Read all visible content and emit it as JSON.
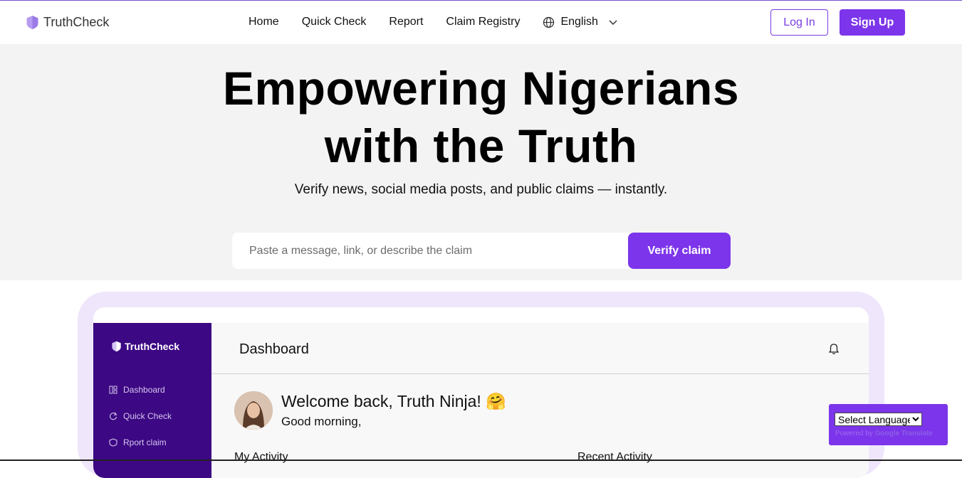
{
  "nav": {
    "brand": "TruthCheck",
    "links": [
      "Home",
      "Quick Check",
      "Report",
      "Claim Registry"
    ],
    "language": "English",
    "login": "Log In",
    "signup": "Sign Up"
  },
  "hero": {
    "title_line1": "Empowering Nigerians",
    "title_line2": "with the Truth",
    "subtitle": "Verify news, social media posts, and public claims — instantly.",
    "search_placeholder": "Paste a message, link, or describe the claim",
    "verify_button": "Verify claim"
  },
  "preview": {
    "brand": "TruthCheck",
    "sidebar": [
      "Dashboard",
      "Quick Check",
      "Rport claim"
    ],
    "header_title": "Dashboard",
    "welcome": "Welcome back, Truth Ninja! 🤗",
    "greeting": "Good morning,",
    "section_left": "My Activity",
    "section_right": "Recent Activity"
  },
  "translate": {
    "select_label": "Select Language",
    "powered_by": "Powered by",
    "google": "Google",
    "translate": "Translate"
  },
  "colors": {
    "accent": "#7c35ea",
    "sidebar": "#3c0883",
    "hero_bg": "#f3f3f3",
    "frame_bg": "#efe6fc"
  }
}
